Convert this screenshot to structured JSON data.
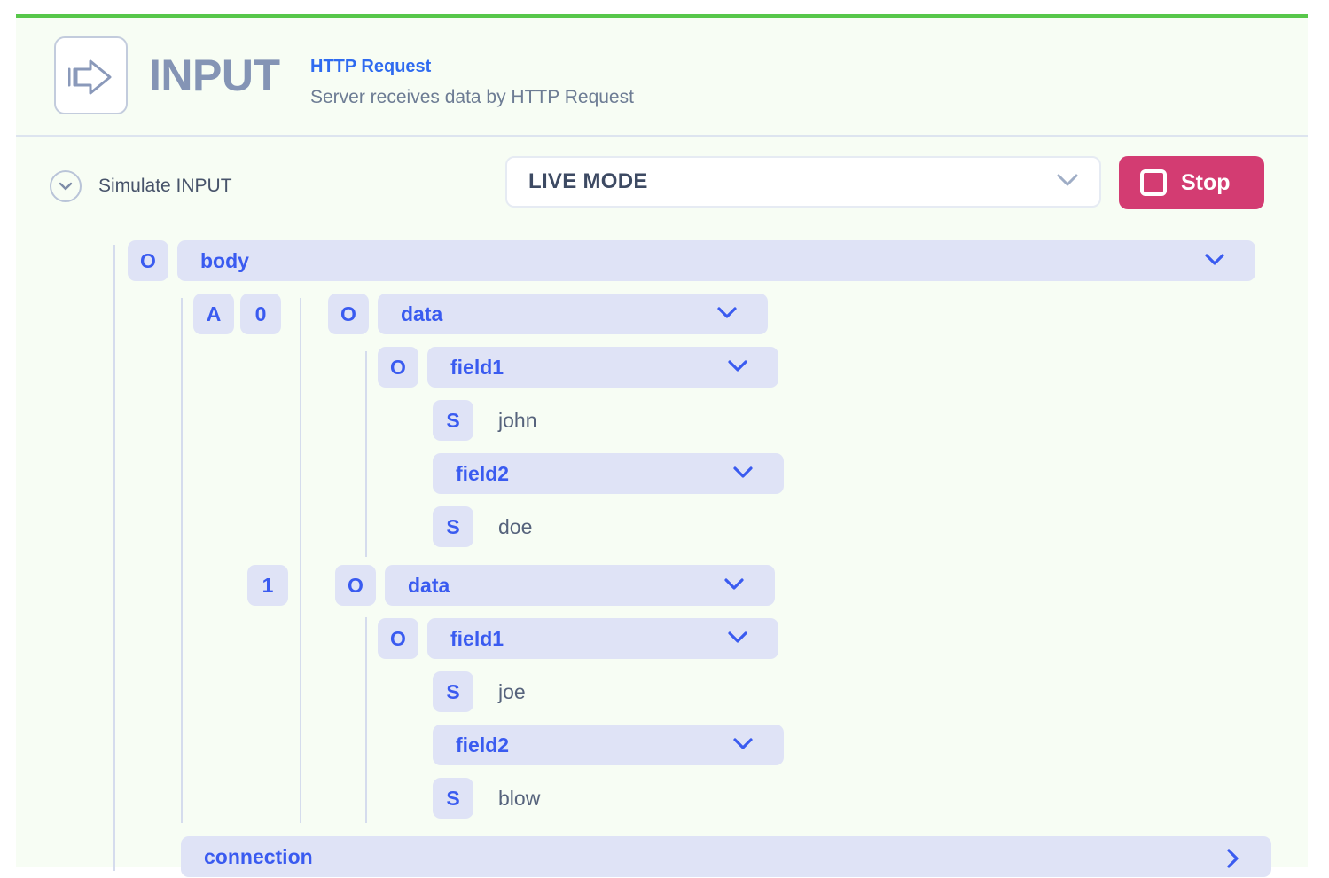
{
  "theme": {
    "accent_green": "#57c74a",
    "panel_bg": "#f7fdf4",
    "pill_bg": "#dfe3f6",
    "key_blue": "#3a5bf0",
    "stop_pink": "#d33c72",
    "title_slate": "#8494b5"
  },
  "header": {
    "icon": "input-arrow-icon",
    "title": "INPUT",
    "subtype": "HTTP Request",
    "description": "Server receives data by HTTP Request"
  },
  "toolbar": {
    "simulate_label": "Simulate INPUT",
    "simulate_chevron": "chevron-down-icon",
    "mode_select": {
      "value": "LIVE MODE",
      "chevron": "chevron-down-icon"
    },
    "stop_button": {
      "label": "Stop",
      "icon": "stop-square-icon"
    }
  },
  "tree": {
    "rows": [
      {
        "badges": [
          "O"
        ],
        "label": "body",
        "chevron": "down",
        "value": null
      },
      {
        "badges": [
          "A",
          "0",
          "O"
        ],
        "label": "data",
        "chevron": "down",
        "value": null
      },
      {
        "badges": [
          "O"
        ],
        "label": "field1",
        "chevron": "down",
        "value": null
      },
      {
        "badges": [
          "S"
        ],
        "label": null,
        "chevron": null,
        "value": "john"
      },
      {
        "badges": [],
        "label": "field2",
        "chevron": "down",
        "value": null
      },
      {
        "badges": [
          "S"
        ],
        "label": null,
        "chevron": null,
        "value": "doe"
      },
      {
        "badges": [
          "1",
          "O"
        ],
        "label": "data",
        "chevron": "down",
        "value": null
      },
      {
        "badges": [
          "O"
        ],
        "label": "field1",
        "chevron": "down",
        "value": null
      },
      {
        "badges": [
          "S"
        ],
        "label": null,
        "chevron": null,
        "value": "joe"
      },
      {
        "badges": [],
        "label": "field2",
        "chevron": "down",
        "value": null
      },
      {
        "badges": [
          "S"
        ],
        "label": null,
        "chevron": null,
        "value": "blow"
      },
      {
        "badges": [],
        "label": "connection",
        "chevron": "right",
        "value": null
      }
    ],
    "labels": {
      "body": "body",
      "connection": "connection",
      "data_0": "data",
      "data_1": "data",
      "field1_a": "field1",
      "field2_a": "field2",
      "field1_b": "field1",
      "field2_b": "field2"
    },
    "badges": {
      "object": "O",
      "array": "A",
      "index_0": "0",
      "index_1": "1",
      "string": "S"
    },
    "values": {
      "john": "john",
      "doe": "doe",
      "joe": "joe",
      "blow": "blow"
    }
  }
}
